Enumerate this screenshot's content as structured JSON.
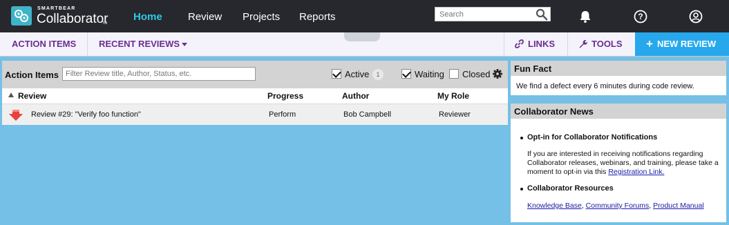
{
  "brand": {
    "small": "SMARTBEAR",
    "name": "Collaborator",
    "tm": "TM"
  },
  "nav": {
    "home": "Home",
    "review": "Review",
    "projects": "Projects",
    "reports": "Reports"
  },
  "search": {
    "placeholder": "Search"
  },
  "subbar": {
    "action_items": "ACTION ITEMS",
    "recent_reviews": "RECENT REVIEWS",
    "links": "LINKS",
    "tools": "TOOLS",
    "new_review": "NEW REVIEW"
  },
  "action_items": {
    "title": "Action Items",
    "filter_placeholder": "Filter Review title, Author, Status, etc.",
    "active_label": "Active",
    "active_count": "1",
    "waiting_label": "Waiting",
    "closed_label": "Closed",
    "columns": {
      "review": "Review",
      "progress": "Progress",
      "author": "Author",
      "role": "My Role"
    },
    "rows": [
      {
        "review": "Review #29: \"Verify foo function\"",
        "progress": "Perform",
        "author": "Bob Campbell",
        "role": "Reviewer"
      }
    ]
  },
  "fun_fact": {
    "title": "Fun Fact",
    "text": "We find a defect every 6 minutes during code review."
  },
  "news": {
    "title": "Collaborator News",
    "item1_title": "Opt-in for Collaborator Notifications",
    "item1_text": "If you are interested in receiving notifications regarding Collaborator releases, webinars, and training, please take a moment to opt-in via this",
    "item1_link": "Registration Link.",
    "item2_title": "Collaborator Resources",
    "link_kb": "Knowledge Base",
    "link_forums": "Community Forums",
    "link_manual": "Product Manual"
  },
  "colors": {
    "accent": "#2ec8e6",
    "purple": "#6a2d91",
    "new_review_bg": "#27a8ec",
    "background": "#74c0e6"
  }
}
